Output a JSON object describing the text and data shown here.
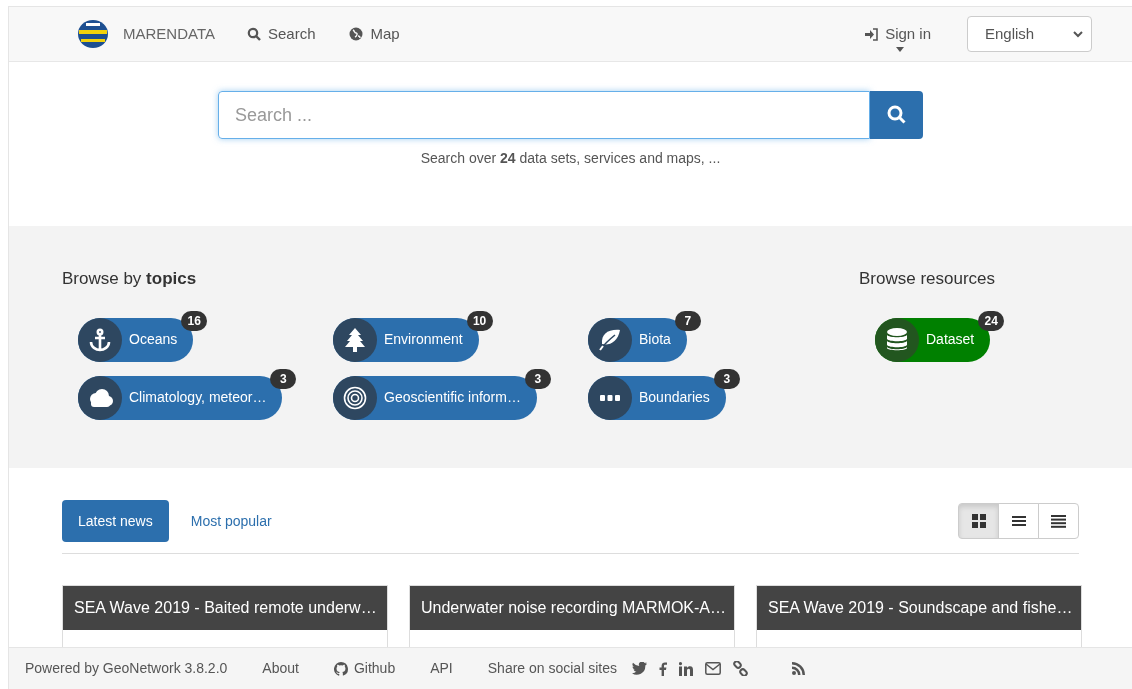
{
  "navbar": {
    "brand": "MARENDATA",
    "links": [
      {
        "label": "Search"
      },
      {
        "label": "Map"
      }
    ],
    "sign_in": "Sign in",
    "language": "English"
  },
  "search": {
    "placeholder": "Search ...",
    "hint": "Search over **24** data sets, services and maps, ..."
  },
  "topics": {
    "title": "Browse by **topics**",
    "items": [
      {
        "label": "Oceans",
        "count": "16"
      },
      {
        "label": "Environment",
        "count": "10"
      },
      {
        "label": "Biota",
        "count": "7"
      },
      {
        "label": "Climatology, meteor…",
        "count": "3"
      },
      {
        "label": "Geoscientific inform…",
        "count": "3"
      },
      {
        "label": "Boundaries",
        "count": "3"
      }
    ]
  },
  "resources": {
    "title": "Browse resources",
    "items": [
      {
        "label": "Dataset",
        "count": "24"
      }
    ]
  },
  "tabs": [
    {
      "label": "Latest news",
      "selected": true
    },
    {
      "label": "Most popular",
      "selected": false
    }
  ],
  "view_modes": [
    {
      "selected": true
    },
    {
      "selected": false
    },
    {
      "selected": false
    }
  ],
  "cards": [
    {
      "title": "SEA Wave 2019 - Baited remote underw…"
    },
    {
      "title": "Underwater noise recording MARMOK-A…"
    },
    {
      "title": "SEA Wave 2019 - Soundscape and fishe…"
    }
  ],
  "footer": {
    "powered": "Powered by GeoNetwork 3.8.2.0",
    "links": [
      {
        "label": "About"
      },
      {
        "label": "Github"
      },
      {
        "label": "API"
      }
    ],
    "share": "Share on social sites"
  }
}
